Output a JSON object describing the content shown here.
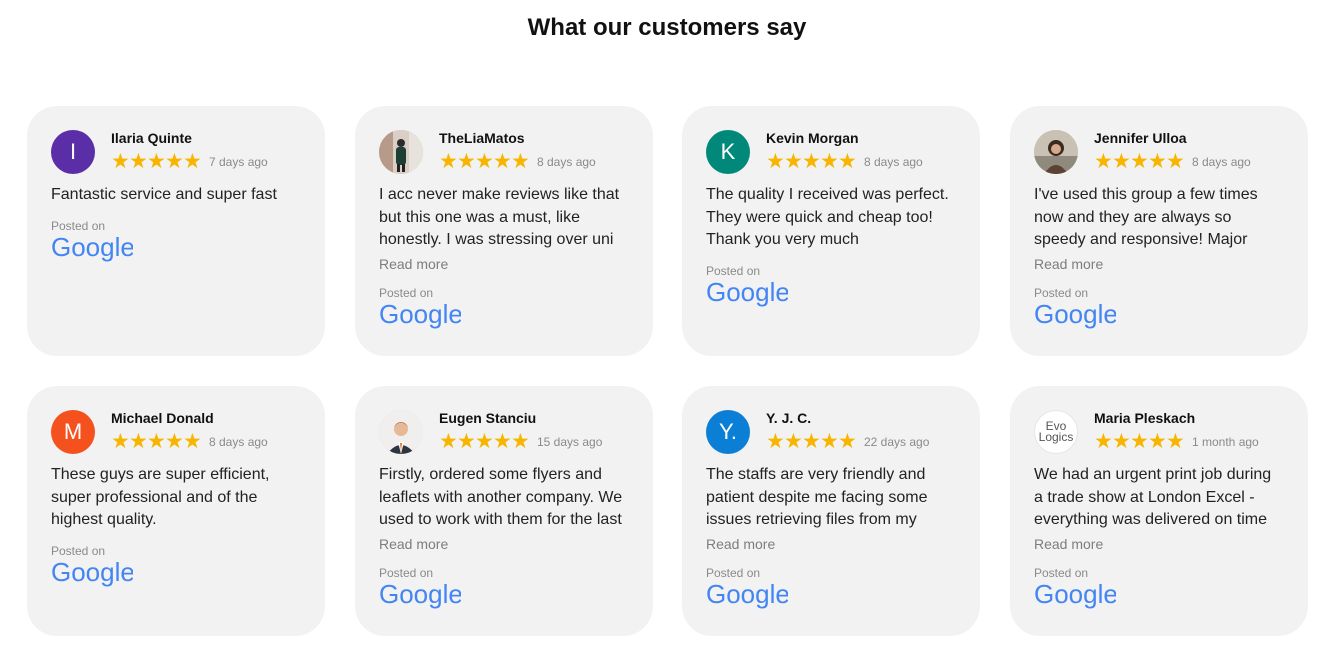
{
  "section": {
    "title": "What our customers say"
  },
  "colors": {
    "star": "#f7b500",
    "google_blue": "#4285F4",
    "card_bg": "#f2f2f2"
  },
  "icons": {
    "star": "star-icon",
    "google": "google-logo"
  },
  "reviews": [
    {
      "name": "Ilaria Quinte",
      "avatar": {
        "type": "initial",
        "letter": "I",
        "color": "#5a2ea6"
      },
      "rating": 5,
      "date": "7 days ago",
      "text": "Fantastic service and super fast",
      "read_more": "",
      "posted_on": "Posted on",
      "source": "Google"
    },
    {
      "name": "TheLiaMatos",
      "avatar": {
        "type": "photo"
      },
      "rating": 5,
      "date": "8 days ago",
      "text": "I acc never make reviews like that but this one was a must, like honestly. I was stressing over uni",
      "read_more": "Read more",
      "posted_on": "Posted on",
      "source": "Google"
    },
    {
      "name": "Kevin Morgan",
      "avatar": {
        "type": "initial",
        "letter": "K",
        "color": "#00897b"
      },
      "rating": 5,
      "date": "8 days ago",
      "text": "The quality I received was perfect. They were quick and cheap too! Thank you very much",
      "read_more": "",
      "posted_on": "Posted on",
      "source": "Google"
    },
    {
      "name": "Jennifer Ulloa",
      "avatar": {
        "type": "photo"
      },
      "rating": 5,
      "date": "8 days ago",
      "text": "I've used this group a few times now and they are always so speedy and responsive! Major",
      "read_more": "Read more",
      "posted_on": "Posted on",
      "source": "Google"
    },
    {
      "name": "Michael Donald",
      "avatar": {
        "type": "initial",
        "letter": "M",
        "color": "#f4511e"
      },
      "rating": 5,
      "date": "8 days ago",
      "text": "These guys are super efficient, super professional and of the highest quality.",
      "read_more": "",
      "posted_on": "Posted on",
      "source": "Google"
    },
    {
      "name": "Eugen Stanciu",
      "avatar": {
        "type": "photo"
      },
      "rating": 5,
      "date": "15 days ago",
      "text": "Firstly, ordered some flyers and leaflets with another company. We used to work with them for the last",
      "read_more": "Read more",
      "posted_on": "Posted on",
      "source": "Google"
    },
    {
      "name": "Y. J. C.",
      "avatar": {
        "type": "initial",
        "letter": "Y.",
        "color": "#0b7fd6"
      },
      "rating": 5,
      "date": "22 days ago",
      "text": "The staffs are very friendly and patient despite me facing some issues retrieving files from my",
      "read_more": "Read more",
      "posted_on": "Posted on",
      "source": "Google"
    },
    {
      "name": "Maria Pleskach",
      "avatar": {
        "type": "logo",
        "text": "Evo Logics"
      },
      "rating": 5,
      "date": "1 month ago",
      "text": "We had an urgent print job during a trade show at London Excel - everything was delivered on time",
      "read_more": "Read more",
      "posted_on": "Posted on",
      "source": "Google"
    }
  ]
}
